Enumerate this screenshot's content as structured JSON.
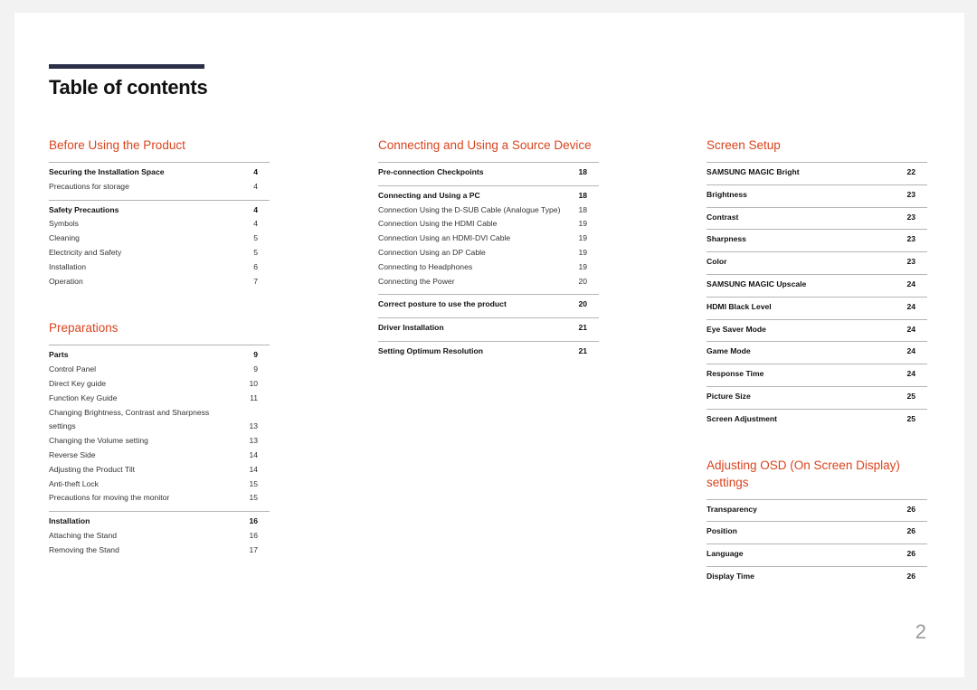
{
  "page": {
    "title": "Table of contents",
    "page_number": "2",
    "accent_color": "#d9441e",
    "title_bar_color": "#2b2f48"
  },
  "columns": [
    {
      "sections": [
        {
          "title": "Before Using the Product",
          "groups": [
            {
              "entries": [
                {
                  "label": "Securing the Installation Space",
                  "page": "4",
                  "bold": true
                },
                {
                  "label": "Precautions for storage",
                  "page": "4",
                  "bold": false
                }
              ]
            },
            {
              "entries": [
                {
                  "label": "Safety Precautions",
                  "page": "4",
                  "bold": true
                },
                {
                  "label": "Symbols",
                  "page": "4",
                  "bold": false
                },
                {
                  "label": "Cleaning",
                  "page": "5",
                  "bold": false
                },
                {
                  "label": "Electricity and Safety",
                  "page": "5",
                  "bold": false
                },
                {
                  "label": "Installation",
                  "page": "6",
                  "bold": false
                },
                {
                  "label": "Operation",
                  "page": "7",
                  "bold": false
                }
              ]
            }
          ]
        },
        {
          "title": "Preparations",
          "groups": [
            {
              "entries": [
                {
                  "label": "Parts",
                  "page": "9",
                  "bold": true
                },
                {
                  "label": "Control Panel",
                  "page": "9",
                  "bold": false
                },
                {
                  "label": "Direct Key guide",
                  "page": "10",
                  "bold": false
                },
                {
                  "label": "Function Key Guide",
                  "page": "11",
                  "bold": false
                },
                {
                  "label": "Changing Brightness, Contrast and Sharpness settings",
                  "page": "13",
                  "bold": false
                },
                {
                  "label": "Changing the Volume setting",
                  "page": "13",
                  "bold": false
                },
                {
                  "label": "Reverse Side",
                  "page": "14",
                  "bold": false
                },
                {
                  "label": "Adjusting the Product Tilt",
                  "page": "14",
                  "bold": false
                },
                {
                  "label": "Anti-theft Lock",
                  "page": "15",
                  "bold": false
                },
                {
                  "label": "Precautions for moving the monitor",
                  "page": "15",
                  "bold": false
                }
              ]
            },
            {
              "entries": [
                {
                  "label": "Installation",
                  "page": "16",
                  "bold": true
                },
                {
                  "label": "Attaching the Stand",
                  "page": "16",
                  "bold": false
                },
                {
                  "label": "Removing the Stand",
                  "page": "17",
                  "bold": false
                }
              ]
            }
          ]
        }
      ]
    },
    {
      "sections": [
        {
          "title": "Connecting and Using a Source Device",
          "groups": [
            {
              "entries": [
                {
                  "label": "Pre-connection Checkpoints",
                  "page": "18",
                  "bold": true
                }
              ]
            },
            {
              "entries": [
                {
                  "label": "Connecting and Using a PC",
                  "page": "18",
                  "bold": true
                },
                {
                  "label": "Connection Using the D-SUB Cable (Analogue Type)",
                  "page": "18",
                  "bold": false
                },
                {
                  "label": "Connection Using the HDMI Cable",
                  "page": "19",
                  "bold": false
                },
                {
                  "label": "Connection Using an HDMI-DVI Cable",
                  "page": "19",
                  "bold": false
                },
                {
                  "label": "Connection Using an DP Cable",
                  "page": "19",
                  "bold": false
                },
                {
                  "label": "Connecting to Headphones",
                  "page": "19",
                  "bold": false
                },
                {
                  "label": "Connecting the Power",
                  "page": "20",
                  "bold": false
                }
              ]
            },
            {
              "entries": [
                {
                  "label": "Correct posture to use the product",
                  "page": "20",
                  "bold": true
                }
              ]
            },
            {
              "entries": [
                {
                  "label": "Driver Installation",
                  "page": "21",
                  "bold": true
                }
              ]
            },
            {
              "entries": [
                {
                  "label": "Setting Optimum Resolution",
                  "page": "21",
                  "bold": true
                }
              ]
            }
          ]
        }
      ]
    },
    {
      "sections": [
        {
          "title": "Screen Setup",
          "groups": [
            {
              "entries": [
                {
                  "label": "SAMSUNG MAGIC Bright",
                  "page": "22",
                  "bold": true
                }
              ]
            },
            {
              "entries": [
                {
                  "label": "Brightness",
                  "page": "23",
                  "bold": true
                }
              ]
            },
            {
              "entries": [
                {
                  "label": "Contrast",
                  "page": "23",
                  "bold": true
                }
              ]
            },
            {
              "entries": [
                {
                  "label": "Sharpness",
                  "page": "23",
                  "bold": true
                }
              ]
            },
            {
              "entries": [
                {
                  "label": "Color",
                  "page": "23",
                  "bold": true
                }
              ]
            },
            {
              "entries": [
                {
                  "label": "SAMSUNG MAGIC Upscale",
                  "page": "24",
                  "bold": true
                }
              ]
            },
            {
              "entries": [
                {
                  "label": "HDMI Black Level",
                  "page": "24",
                  "bold": true
                }
              ]
            },
            {
              "entries": [
                {
                  "label": "Eye Saver Mode",
                  "page": "24",
                  "bold": true
                }
              ]
            },
            {
              "entries": [
                {
                  "label": "Game Mode",
                  "page": "24",
                  "bold": true
                }
              ]
            },
            {
              "entries": [
                {
                  "label": "Response Time",
                  "page": "24",
                  "bold": true
                }
              ]
            },
            {
              "entries": [
                {
                  "label": "Picture Size",
                  "page": "25",
                  "bold": true
                }
              ]
            },
            {
              "entries": [
                {
                  "label": "Screen Adjustment",
                  "page": "25",
                  "bold": true
                }
              ]
            }
          ]
        },
        {
          "title": "Adjusting OSD (On Screen Display) settings",
          "groups": [
            {
              "entries": [
                {
                  "label": "Transparency",
                  "page": "26",
                  "bold": true
                }
              ]
            },
            {
              "entries": [
                {
                  "label": "Position",
                  "page": "26",
                  "bold": true
                }
              ]
            },
            {
              "entries": [
                {
                  "label": "Language",
                  "page": "26",
                  "bold": true
                }
              ]
            },
            {
              "entries": [
                {
                  "label": "Display Time",
                  "page": "26",
                  "bold": true
                }
              ]
            }
          ]
        }
      ]
    }
  ]
}
